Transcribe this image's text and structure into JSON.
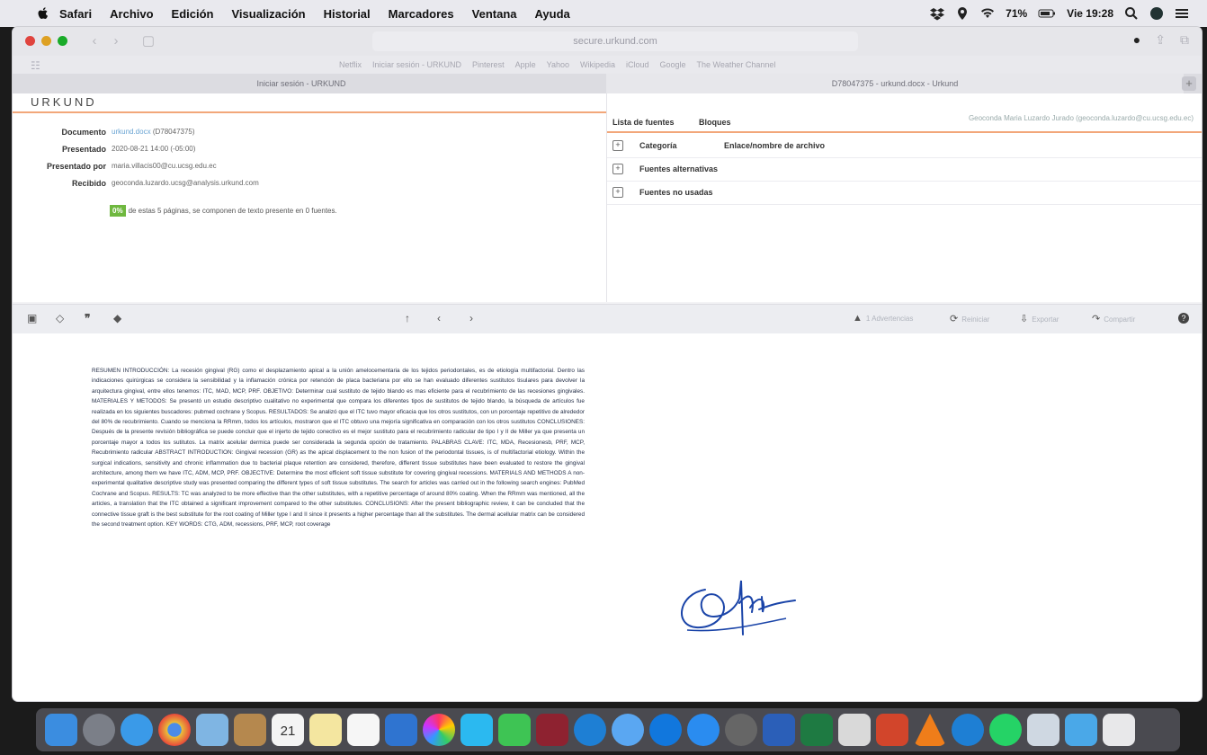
{
  "menubar": {
    "app": "Safari",
    "items": [
      "Archivo",
      "Edición",
      "Visualización",
      "Historial",
      "Marcadores",
      "Ventana",
      "Ayuda"
    ],
    "battery": "71%",
    "clock": "Vie 19:28"
  },
  "browser": {
    "address": "secure.urkund.com",
    "favorites": [
      "Netflix",
      "Iniciar sesión - URKUND",
      "Pinterest",
      "Apple",
      "Yahoo",
      "Wikipedia",
      "iCloud",
      "Google",
      "The Weather Channel"
    ],
    "tabs": [
      "Iniciar sesión - URKUND",
      "D78047375 - urkund.docx - Urkund"
    ]
  },
  "urkund": {
    "logo": "URKUND",
    "meta": {
      "documento_label": "Documento",
      "documento_link": "urkund.docx",
      "documento_id": "(D78047375)",
      "presentado_label": "Presentado",
      "presentado_val": "2020-08-21 14:00 (-05:00)",
      "presentado_por_label": "Presentado por",
      "presentado_por_val": "maria.villacis00@cu.ucsg.edu.ec",
      "recibido_label": "Recibido",
      "recibido_val": "geoconda.luzardo.ucsg@analysis.urkund.com"
    },
    "summary_pct": "0%",
    "summary_text": "de estas 5 páginas, se componen de texto presente en 0 fuentes.",
    "sources": {
      "tab1": "Lista de fuentes",
      "tab2": "Bloques",
      "user": "Geoconda Maria Luzardo Jurado (geoconda.luzardo@cu.ucsg.edu.ec)",
      "categoria": "Categoría",
      "enlace": "Enlace/nombre de archivo",
      "alternativas": "Fuentes alternativas",
      "no_usadas": "Fuentes no usadas"
    },
    "tools": {
      "advertencias": "1 Advertencias",
      "reiniciar": "Reiniciar",
      "exportar": "Exportar",
      "compartir": "Compartir"
    },
    "document_text": "RESUMEN INTRODUCCIÓN: La recesión gingival (RG) como el desplazamiento apical a la unión amelocementaria de los tejidos periodontales, es de etiología multifactorial. Dentro las indicaciones quirúrgicas se considera la sensibilidad y la inflamación crónica por retención de placa bacteriana por ello se han evaluado diferentes sustitutos tisulares para devolver la arquitectura gingival, entre ellos tenemos: ITC, MAD, MCP, PRF. OBJETIVO: Determinar cual sustituto de tejido blando es mas eficiente para el recubrimiento de las recesiones gingivales. MATERIALES Y METODOS: Se presentó un estudio descriptivo cualitativo no experimental que compara los diferentes tipos de sustitutos de tejido blando, la búsqueda de artículos fue realizada en los siguientes buscadores: pubmed cochrane y Scopus. RESULTADOS: Se analizó que el ITC tuvo mayor eficacia que los otros sustitutos, con un porcentaje repetitivo de alrededor del 80% de recubrimiento. Cuando se menciona la RRmm, todos los artículos, mostraron que el ITC obtuvo una mejoría significativa en comparación con los otros sustitutos CONCLUSIONES: Después de la presente revisión bibliográfica se puede concluir que el injerto de tejido conectivo es el mejor sustituto para el recubrimiento radicular de tipo I y II de Miller ya que presenta un porcentaje mayor a todos los sutitutos. La matrix acelular dermica puede ser considerada la segunda opción de tratamiento. PALABRAS CLAVE: ITC, MDA, Recesionesb, PRF, MCP, Recubrimiento radicular ABSTRACT INTRODUCTION: Gingival recession (GR) as the apical displacement to the non fusion of the periodontal tissues, is of multifactorial etiology. Within the surgical indications, sensitivity and chronic inflammation due to bacterial plaque retention are considered, therefore, different tissue substitutes have been evaluated to restore the gingival architecture, among them we have ITC, ADM, MCP, PRF. OBJECTIVE: Determine the most efficient soft tissue substitute for covering gingival recessions. MATERIALS AND METHODS A non-experimental qualitative descriptive study was presented comparing the different types of soft tissue substitutes. The search for articles was carried out in the following search engines: PubMed Cochrane and Scopus. RESULTS: TC was analyzed to be more effective than the other substitutes, with a repetitive percentage of around 80% coating. When the RRmm was mentioned, all the articles, a translation that the ITC obtained a significant improvement compared to the other substitutes. CONCLUSIONS: After the present bibliographic review, it can be concluded that the connective tissue graft is the best substitute for the root coating of Miller type I and II since it presents a higher percentage than all the substitutes. The dermal acellular matrix can be considered the second treatment option. KEY WORDS: CTG, ADM, recessions, PRF, MCP, root coverage"
  },
  "dock": {
    "apps": [
      "finder-icon",
      "launchpad-icon",
      "safari-icon",
      "chrome-icon",
      "preview-icon",
      "contacts-icon",
      "calendar-icon",
      "notes-icon",
      "reminders-icon",
      "keynote-icon",
      "photos-icon",
      "messages-icon",
      "facetime-icon",
      "photobooth-icon",
      "edge-icon",
      "music-icon",
      "teamviewer-icon",
      "appstore-icon",
      "preferences-icon",
      "word-icon",
      "excel-icon",
      "acrobat-icon",
      "powerpoint-icon",
      "vlc-icon",
      "edge2-icon",
      "whatsapp-icon",
      "scanner-icon",
      "downloads-icon",
      "trash-icon"
    ],
    "calendar_day": "21"
  }
}
